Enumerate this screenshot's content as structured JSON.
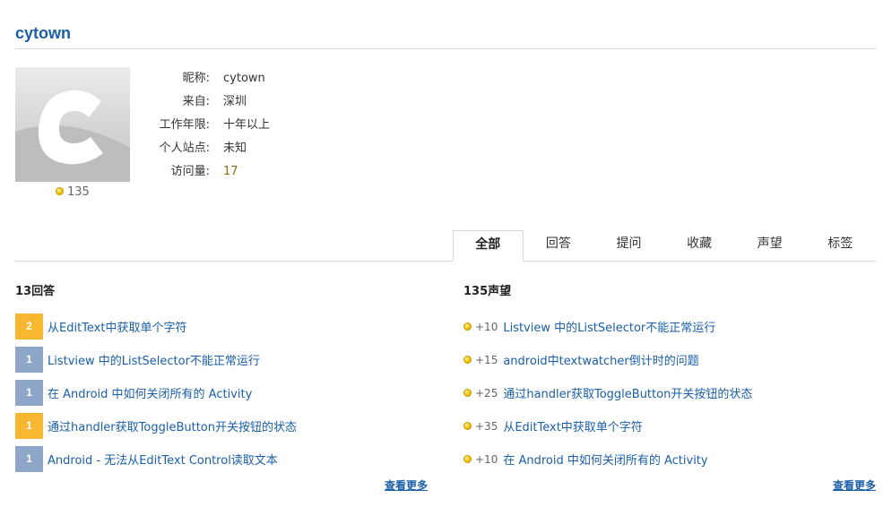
{
  "profile": {
    "username": "cytown",
    "reputation": "135",
    "avatar_letter": "C",
    "fields": [
      {
        "label": "昵称:",
        "value": "cytown"
      },
      {
        "label": "来自:",
        "value": "深圳"
      },
      {
        "label": "工作年限:",
        "value": "十年以上"
      },
      {
        "label": "个人站点:",
        "value": "未知"
      },
      {
        "label": "访问量:",
        "value": "17"
      }
    ]
  },
  "tabs": [
    "全部",
    "回答",
    "提问",
    "收藏",
    "声望",
    "标签"
  ],
  "active_tab": "全部",
  "answers_section": {
    "title": "13回答",
    "items": [
      {
        "votes": "2",
        "title": "从EditText中获取单个字符",
        "highlight": true
      },
      {
        "votes": "1",
        "title": "Listview 中的ListSelector不能正常运行",
        "highlight": false
      },
      {
        "votes": "1",
        "title": "在 Android 中如何关闭所有的 Activity",
        "highlight": false
      },
      {
        "votes": "1",
        "title": "通过handler获取ToggleButton开关按钮的状态",
        "highlight": true
      },
      {
        "votes": "1",
        "title": "Android - 无法从EditText Control读取文本",
        "highlight": false
      }
    ],
    "more_label": "查看更多"
  },
  "reputation_section": {
    "title": "135声望",
    "items": [
      {
        "delta": "+10",
        "title": "Listview 中的ListSelector不能正常运行"
      },
      {
        "delta": "+15",
        "title": "android中textwatcher倒计时的问题"
      },
      {
        "delta": "+25",
        "title": "通过handler获取ToggleButton开关按钮的状态"
      },
      {
        "delta": "+35",
        "title": "从EditText中获取单个字符"
      },
      {
        "delta": "+10",
        "title": "在 Android 中如何关闭所有的 Activity"
      }
    ],
    "more_label": "查看更多"
  },
  "colors": {
    "link": "#1a5fa8",
    "vote_highlight": "#f7b731",
    "vote_normal": "#8ea7c8"
  }
}
